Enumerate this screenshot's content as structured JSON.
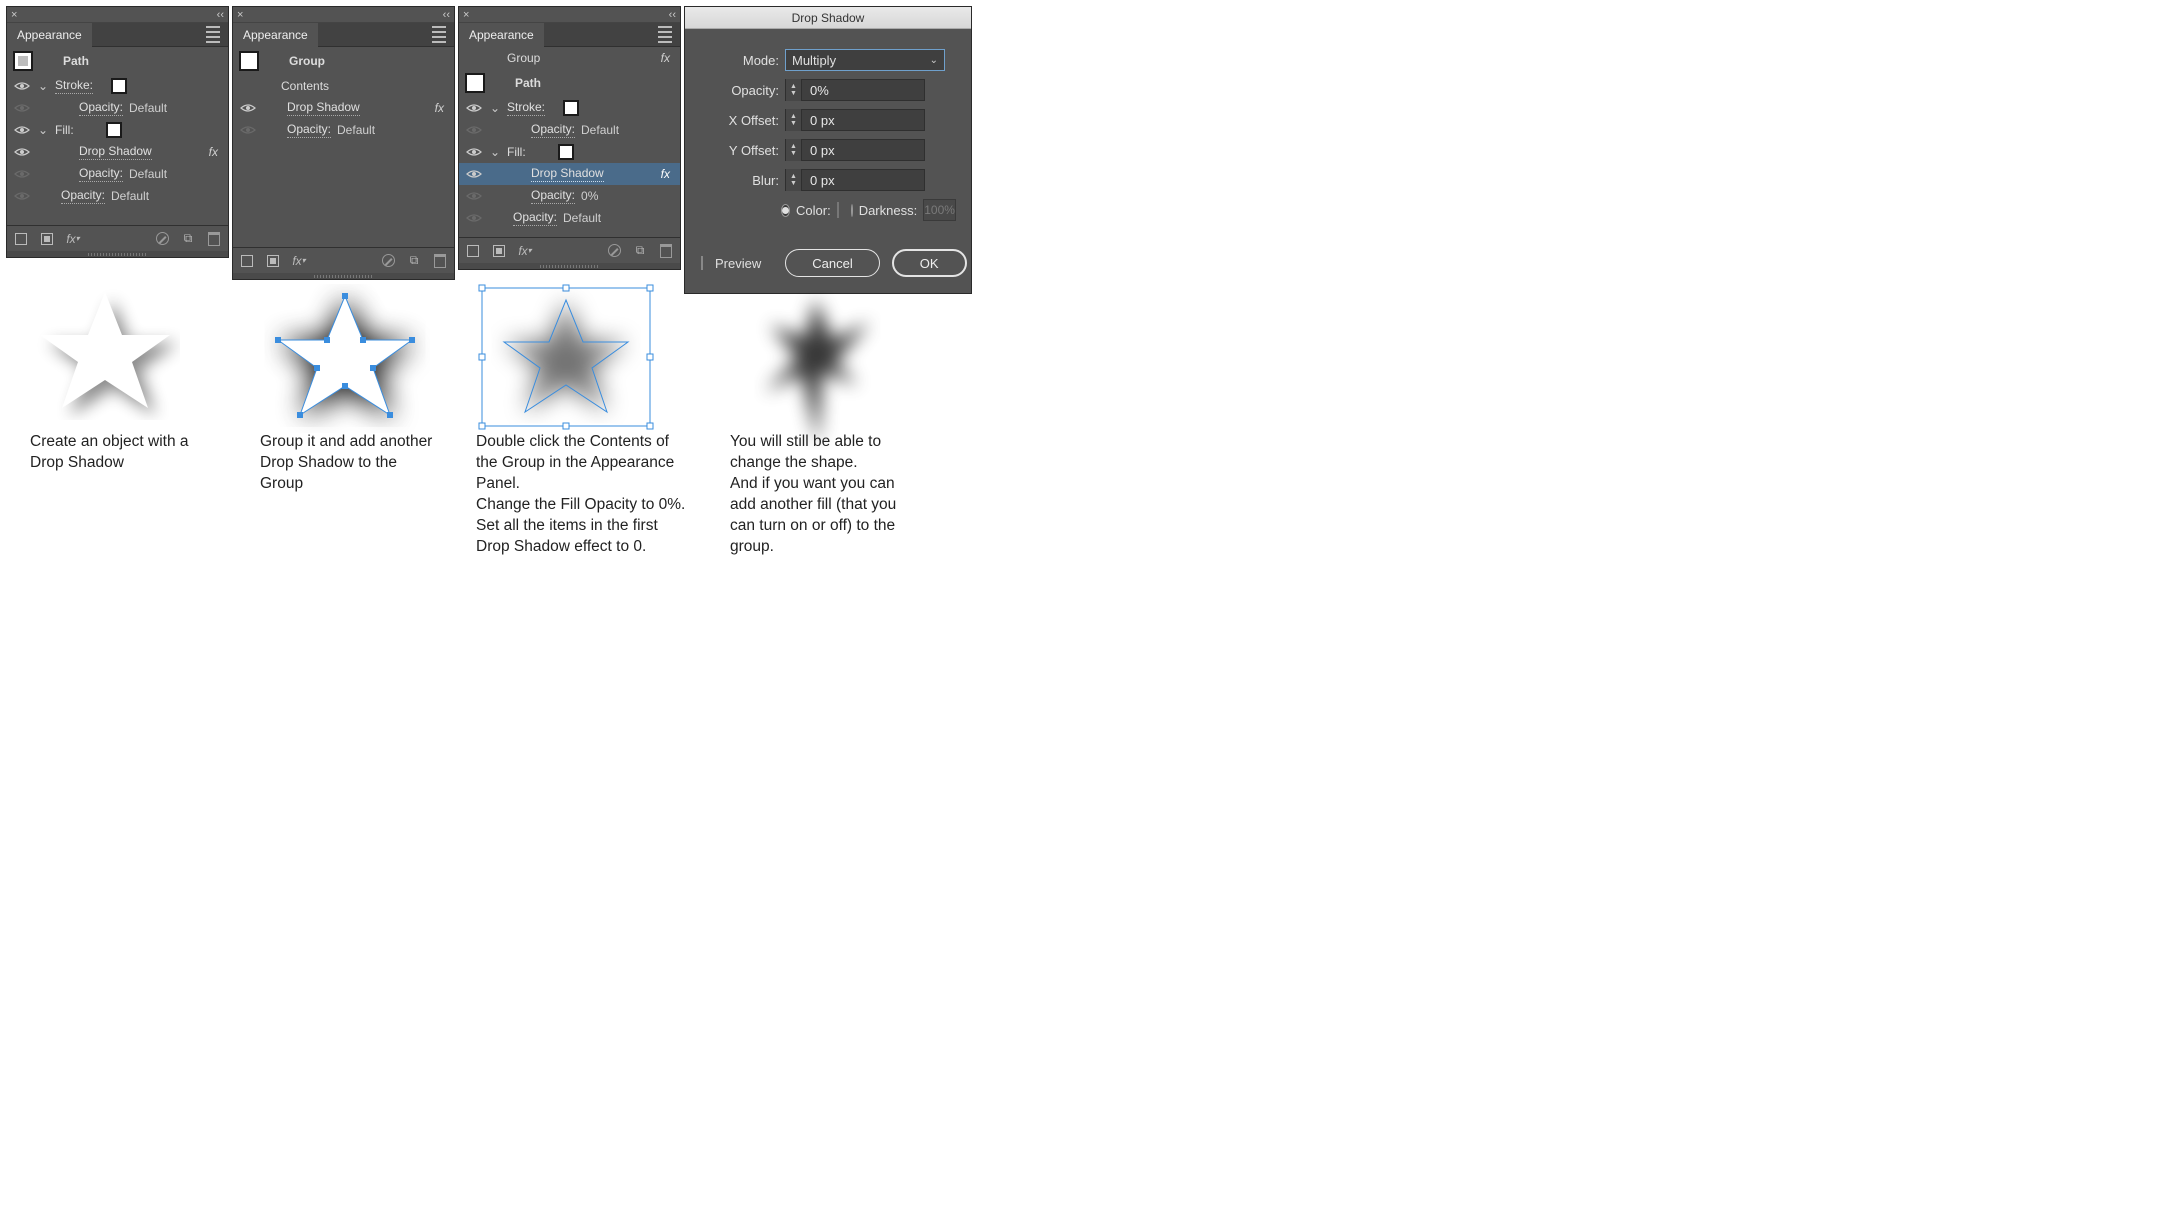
{
  "panels": [
    {
      "title": "Appearance",
      "header": "Path",
      "rows": [
        {
          "label": "Stroke:"
        },
        {
          "label": "Opacity:",
          "value": "Default"
        },
        {
          "label": "Fill:"
        },
        {
          "label": "Drop Shadow"
        },
        {
          "label": "Opacity:",
          "value": "Default"
        },
        {
          "label": "Opacity:",
          "value": "Default"
        }
      ]
    },
    {
      "title": "Appearance",
      "header": "Group",
      "rows": [
        {
          "label": "Contents"
        },
        {
          "label": "Drop Shadow"
        },
        {
          "label": "Opacity:",
          "value": "Default"
        }
      ]
    },
    {
      "title": "Appearance",
      "header": "Group",
      "header2": "Path",
      "rows": [
        {
          "label": "Stroke:"
        },
        {
          "label": "Opacity:",
          "value": "Default"
        },
        {
          "label": "Fill:"
        },
        {
          "label": "Drop Shadow"
        },
        {
          "label": "Opacity:",
          "value": "0%"
        },
        {
          "label": "Opacity:",
          "value": "Default"
        }
      ]
    }
  ],
  "dialog": {
    "title": "Drop Shadow",
    "mode_label": "Mode:",
    "mode_value": "Multiply",
    "opacity_label": "Opacity:",
    "opacity_value": "0%",
    "xoffset_label": "X Offset:",
    "xoffset_value": "0 px",
    "yoffset_label": "Y Offset:",
    "yoffset_value": "0 px",
    "blur_label": "Blur:",
    "blur_value": "0 px",
    "color_label": "Color:",
    "darkness_label": "Darkness:",
    "darkness_value": "100%",
    "preview_label": "Preview",
    "cancel": "Cancel",
    "ok": "OK"
  },
  "captions": {
    "c1": "Create an object with a Drop Shadow",
    "c2": "Group it and add another Drop Shadow to the Group",
    "c3": "Double click the Contents of the Group in the Appearance Panel.\nChange the Fill Opacity to 0%. Set all the items in the first Drop Shadow effect to 0.",
    "c4": "You will still be able to change the shape.\nAnd if you want you can add another fill (that you can turn on or off) to the group."
  },
  "fx_label": "fx"
}
